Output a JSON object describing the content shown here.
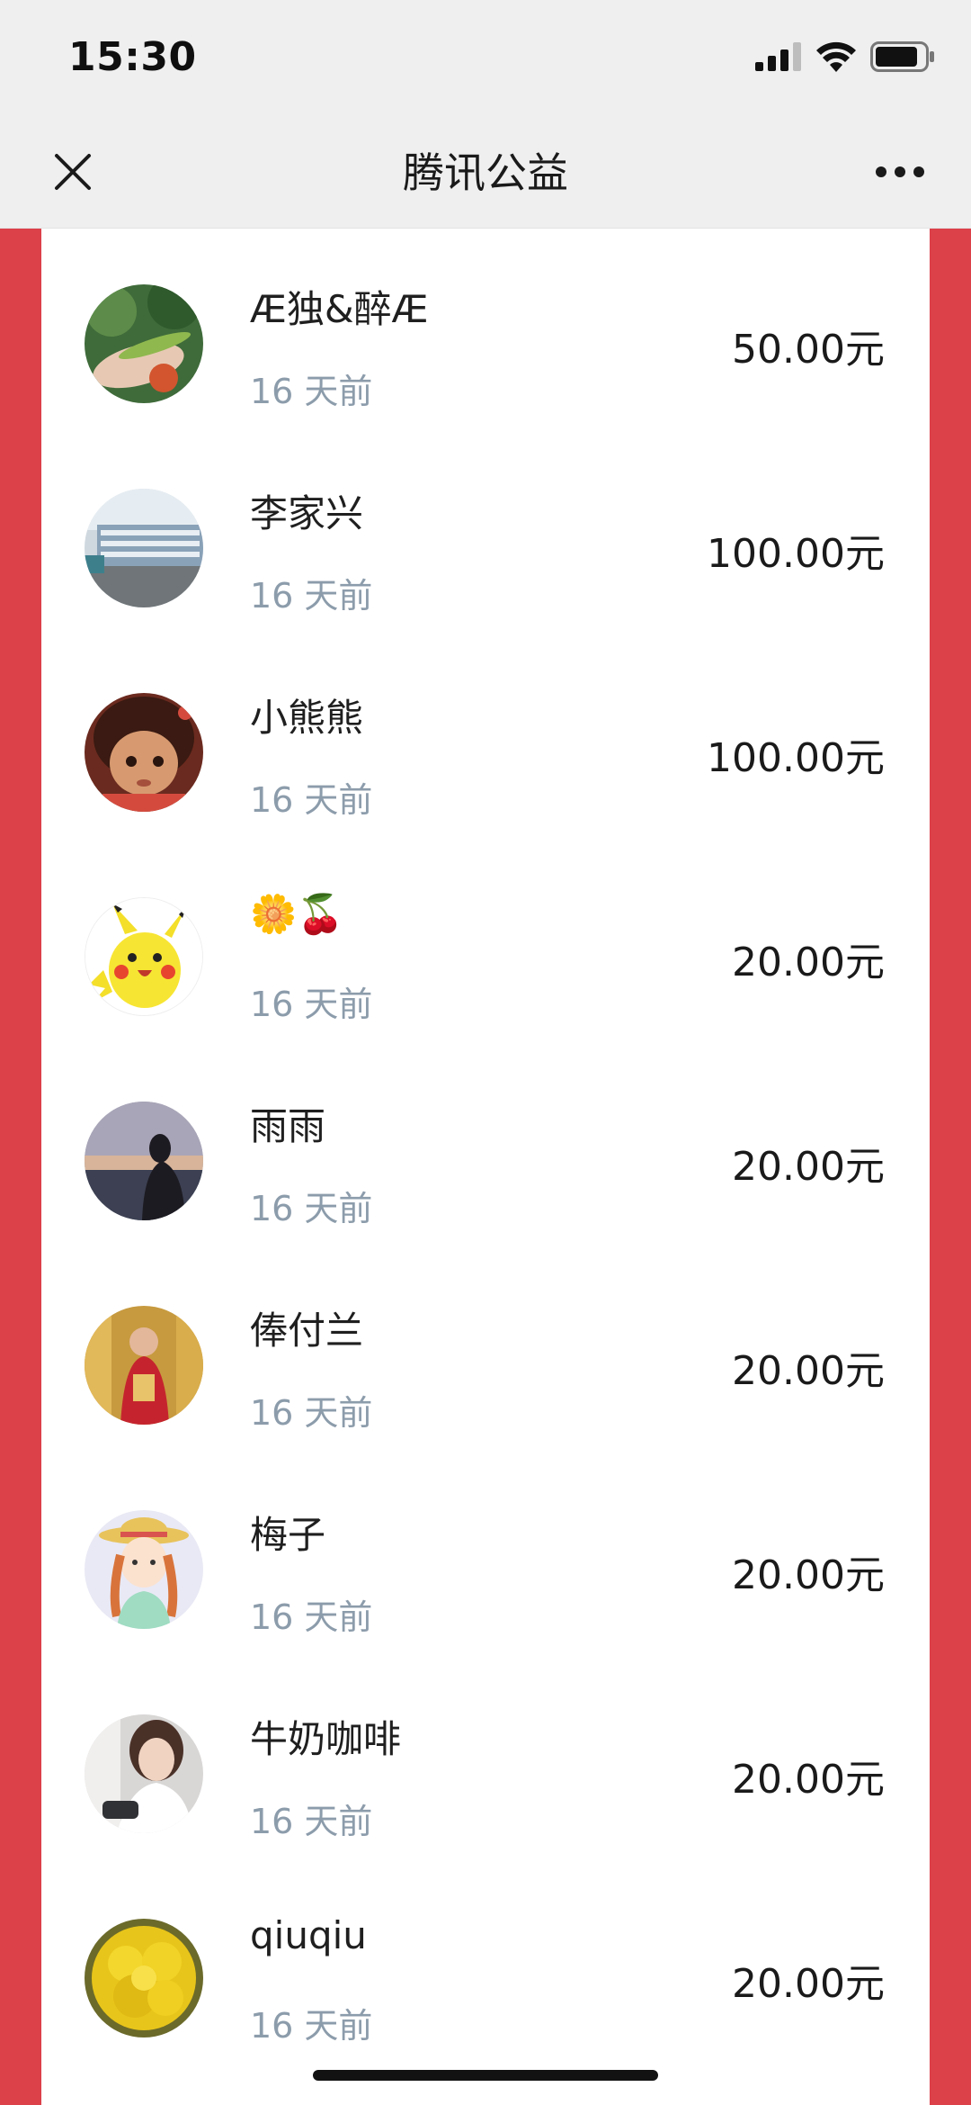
{
  "status_bar": {
    "time": "15:30",
    "icons": [
      "cellular-signal-icon",
      "wifi-icon",
      "battery-icon"
    ]
  },
  "nav": {
    "title": "腾讯公益",
    "close_icon": "close-icon",
    "more_icon": "more-icon"
  },
  "colors": {
    "background_red": "#dc4049",
    "time_gray": "#8c9cab",
    "card_white": "#ffffff"
  },
  "donors": [
    {
      "name": "Æ独&醉Æ",
      "time": "16 天前",
      "amount": "50.00元",
      "avatar": "plant-hand-photo"
    },
    {
      "name": "李家兴",
      "time": "16 天前",
      "amount": "100.00元",
      "avatar": "harbor-boats-photo"
    },
    {
      "name": "小熊熊",
      "time": "16 天前",
      "amount": "100.00元",
      "avatar": "cartoon-girl-photo"
    },
    {
      "name": "🌼🍒",
      "time": "16 天前",
      "amount": "20.00元",
      "avatar": "pikachu-avatar"
    },
    {
      "name": "雨雨",
      "time": "16 天前",
      "amount": "20.00元",
      "avatar": "sunset-silhouette-photo"
    },
    {
      "name": "俸付兰",
      "time": "16 天前",
      "amount": "20.00元",
      "avatar": "golden-temple-photo"
    },
    {
      "name": "梅子",
      "time": "16 天前",
      "amount": "20.00元",
      "avatar": "anne-cartoon-avatar"
    },
    {
      "name": "牛奶咖啡",
      "time": "16 天前",
      "amount": "20.00元",
      "avatar": "woman-selfie-photo"
    },
    {
      "name": "qiuqiu",
      "time": "16 天前",
      "amount": "20.00元",
      "avatar": "yellow-flower-photo"
    }
  ]
}
